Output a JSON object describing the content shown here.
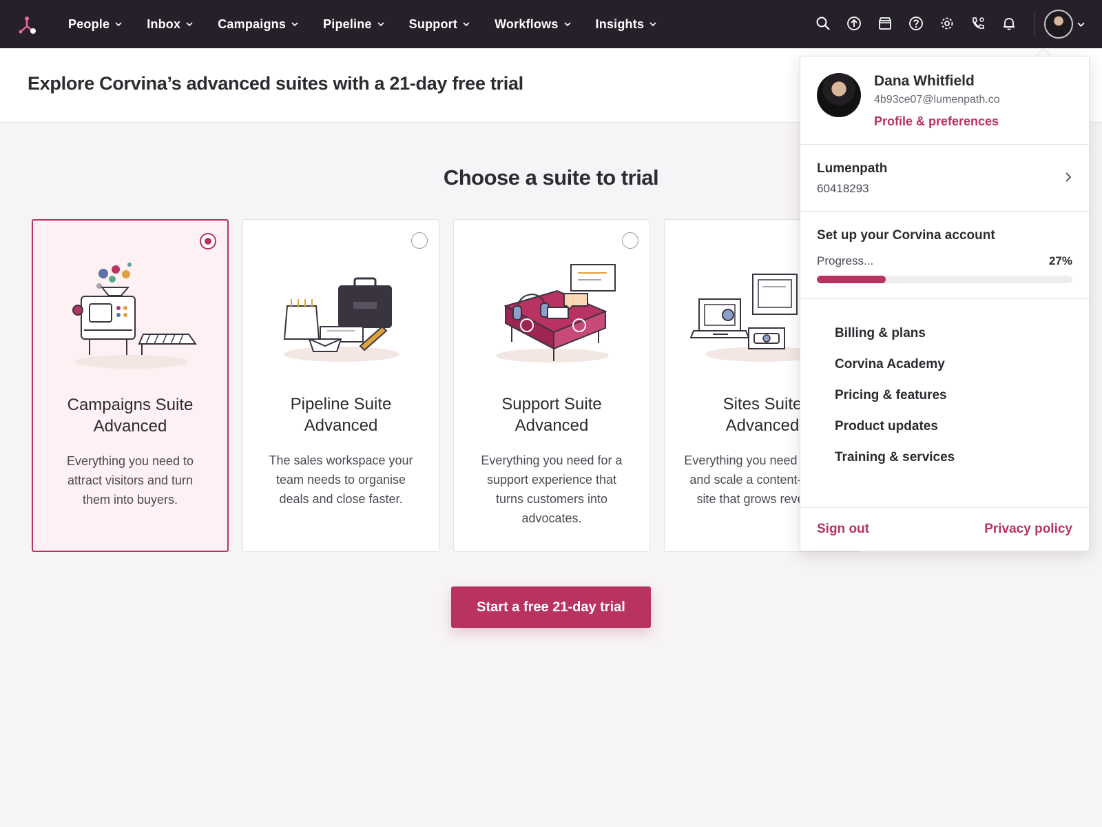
{
  "colors": {
    "nav_bg": "#25202a",
    "accent": "#b83262",
    "selected_card_bg": "#fdf1f4",
    "page_bg": "#f6f4f6"
  },
  "nav": {
    "logo_icon": "sprocket-logo-icon",
    "items": [
      {
        "label": "People"
      },
      {
        "label": "Inbox"
      },
      {
        "label": "Campaigns"
      },
      {
        "label": "Pipeline"
      },
      {
        "label": "Support"
      },
      {
        "label": "Workflows"
      },
      {
        "label": "Insights"
      }
    ],
    "icons": [
      "search-icon",
      "upgrade-icon",
      "marketplace-icon",
      "help-icon",
      "settings-icon",
      "calling-icon",
      "notifications-icon"
    ]
  },
  "banner": {
    "title": "Explore Corvina’s advanced suites with a 21-day free trial"
  },
  "main": {
    "heading": "Choose a suite to trial",
    "cards": [
      {
        "title_line1": "Campaigns Suite",
        "title_line2": "Advanced",
        "description": "Everything you need to attract visitors and turn them into buyers.",
        "selected": true
      },
      {
        "title_line1": "Pipeline Suite",
        "title_line2": "Advanced",
        "description": "The sales workspace your team needs to organise deals and close faster.",
        "selected": false
      },
      {
        "title_line1": "Support Suite",
        "title_line2": "Advanced",
        "description": "Everything you need for a support experience that turns customers into advocates.",
        "selected": false
      },
      {
        "title_line1": "Sites Suite",
        "title_line2": "Advanced",
        "description": "Everything you need to build and scale a content-driven site that grows revenue.",
        "selected": false
      }
    ],
    "cta_label": "Start a free 21-day trial"
  },
  "dropdown": {
    "name": "Dana Whitfield",
    "email": "4b93ce07@lumenpath.co",
    "profile_link": "Profile & preferences",
    "account_name": "Lumenpath",
    "account_id": "60418293",
    "setup_title": "Set up your Corvina account",
    "progress_label": "Progress...",
    "progress_percent": "27%",
    "progress_value": 0.27,
    "links": [
      {
        "label": "Billing & plans"
      },
      {
        "label": "Corvina Academy"
      },
      {
        "label": "Pricing & features"
      },
      {
        "label": "Product updates"
      },
      {
        "label": "Training & services"
      }
    ],
    "sign_out": "Sign out",
    "privacy": "Privacy policy"
  }
}
